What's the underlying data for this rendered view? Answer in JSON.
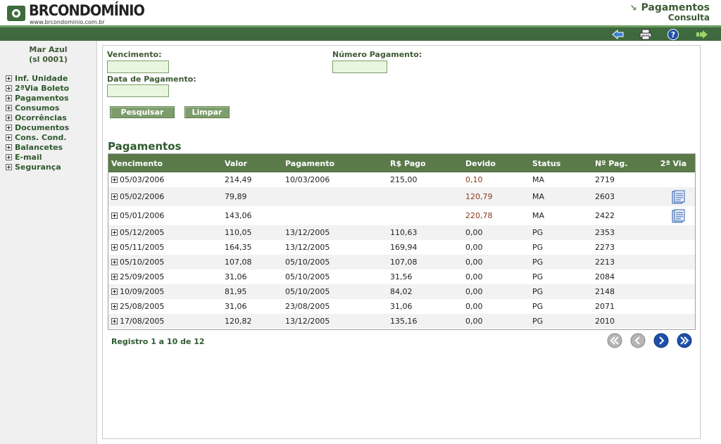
{
  "header": {
    "logo_text": "BRCONDOMÍNIO",
    "logo_url": "www.brcondominio.com.br",
    "title": "Pagamentos",
    "subtitle": "Consulta"
  },
  "toolbar": {
    "icons": [
      "back-icon",
      "print-icon",
      "help-icon",
      "exit-icon"
    ]
  },
  "sidebar": {
    "unit_name": "Mar Azul",
    "unit_code": "(sl 0001)",
    "items": [
      {
        "label": "Inf. Unidade"
      },
      {
        "label": "2ªVia Boleto"
      },
      {
        "label": "Pagamentos"
      },
      {
        "label": "Consumos"
      },
      {
        "label": "Ocorrências"
      },
      {
        "label": "Documentos"
      },
      {
        "label": "Cons. Cond."
      },
      {
        "label": "Balancetes"
      },
      {
        "label": "E-mail"
      },
      {
        "label": "Segurança"
      }
    ]
  },
  "search": {
    "vencimento_label": "Vencimento:",
    "vencimento_value": "",
    "numero_label": "Número Pagamento:",
    "numero_value": "",
    "data_pagamento_label": "Data de Pagamento:",
    "data_pagamento_value": "",
    "search_button": "Pesquisar",
    "clear_button": "Limpar"
  },
  "table": {
    "title": "Pagamentos",
    "columns": [
      "Vencimento",
      "Valor",
      "Pagamento",
      "R$ Pago",
      "Devido",
      "Status",
      "Nº Pag.",
      "2ª Via"
    ],
    "rows": [
      [
        "05/03/2006",
        "214,49",
        "10/03/2006",
        "215,00",
        "0,10",
        "MA",
        "2719",
        ""
      ],
      [
        "05/02/2006",
        "79,89",
        "",
        "",
        "120,79",
        "MA",
        "2603",
        "document-icon"
      ],
      [
        "05/01/2006",
        "143,06",
        "",
        "",
        "220,78",
        "MA",
        "2422",
        "document-icon"
      ],
      [
        "05/12/2005",
        "110,05",
        "13/12/2005",
        "110,63",
        "0,00",
        "PG",
        "2353",
        ""
      ],
      [
        "05/11/2005",
        "164,35",
        "13/12/2005",
        "169,94",
        "0,00",
        "PG",
        "2273",
        ""
      ],
      [
        "05/10/2005",
        "107,08",
        "05/10/2005",
        "107,08",
        "0,00",
        "PG",
        "2213",
        ""
      ],
      [
        "25/09/2005",
        "31,06",
        "05/10/2005",
        "31,56",
        "0,00",
        "PG",
        "2084",
        ""
      ],
      [
        "10/09/2005",
        "81,95",
        "05/10/2005",
        "84,02",
        "0,00",
        "PG",
        "2148",
        ""
      ],
      [
        "25/08/2005",
        "31,06",
        "23/08/2005",
        "31,06",
        "0,00",
        "PG",
        "2071",
        ""
      ],
      [
        "17/08/2005",
        "120,82",
        "13/12/2005",
        "135,16",
        "0,00",
        "PG",
        "2010",
        ""
      ]
    ],
    "records_text": "Registro 1 a 10 de 12"
  },
  "pagination": {
    "icons": [
      "first-page-icon",
      "prev-page-icon",
      "next-page-icon",
      "last-page-icon"
    ]
  },
  "colors": {
    "brand_green": "#3f6a3f",
    "header_row": "#5a7a4a",
    "due_red": "#8b3a1a",
    "field_bg": "#e8f5df"
  }
}
